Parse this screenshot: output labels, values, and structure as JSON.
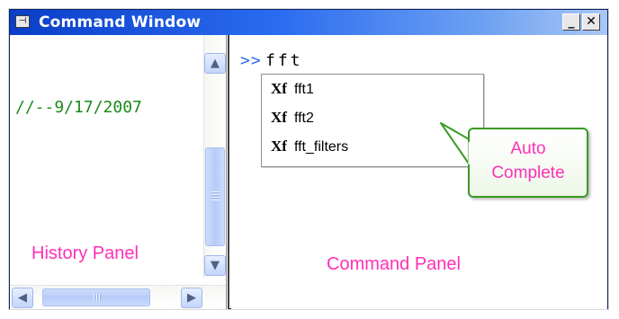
{
  "window": {
    "title": "Command Window",
    "icon": "pin-icon",
    "minimize_glyph": "_",
    "close_glyph": "✕"
  },
  "history": {
    "entry": "//--9/17/2007",
    "label": "History Panel",
    "scroll_up_glyph": "▲",
    "scroll_down_glyph": "▼",
    "scroll_left_glyph": "◀",
    "scroll_right_glyph": "▶"
  },
  "command": {
    "prompt": ">>",
    "input": "fft",
    "label": "Command Panel"
  },
  "autocomplete": {
    "items": [
      {
        "icon": "Xf",
        "label": "fft1"
      },
      {
        "icon": "Xf",
        "label": "fft2"
      },
      {
        "icon": "Xf",
        "label": "fft_filters"
      }
    ]
  },
  "callout": {
    "line1": "Auto",
    "line2": "Complete"
  },
  "colors": {
    "titlebar": "#0a3ec8",
    "annotation_text": "#ff2fb6",
    "callout_border": "#3a9a24",
    "history_text": "#1a8a1a",
    "prompt": "#2a6cf0"
  }
}
